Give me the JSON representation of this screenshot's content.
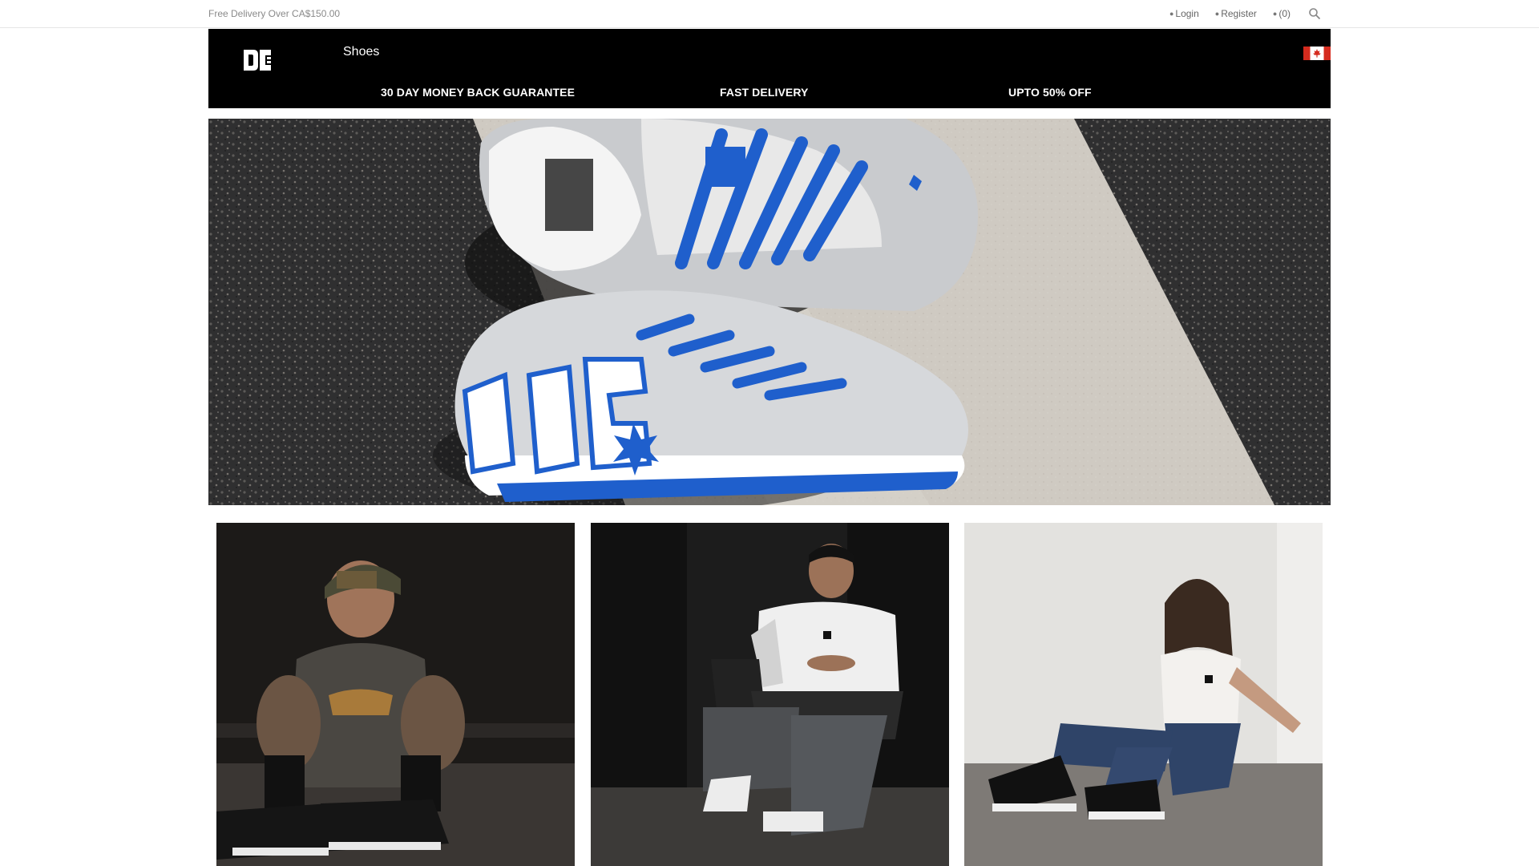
{
  "topbar": {
    "promo": "Free Delivery Over CA$150.00",
    "login_icon": "user-icon",
    "login": "Login",
    "register_icon": "register-icon",
    "register": "Register",
    "cart_icon": "cart-icon",
    "cart": "(0)",
    "search_icon": "search-icon"
  },
  "header": {
    "logo": "dc-logo",
    "nav": {
      "shoes": "Shoes"
    },
    "flag": "canada-flag-icon",
    "benefits": [
      "30 DAY MONEY BACK GUARANTEE",
      "FAST DELIVERY",
      "UPTO 50% OFF"
    ]
  },
  "colors": {
    "header_bg": "#000000",
    "accent_blue": "#1f5fcc",
    "promo_text": "#8a8a8a"
  }
}
